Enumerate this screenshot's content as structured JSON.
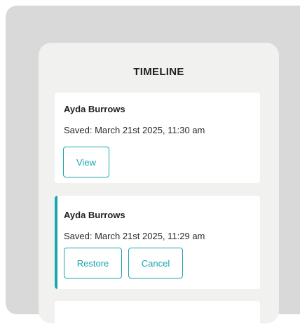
{
  "timeline": {
    "title": "TIMELINE",
    "entries": [
      {
        "author": "Ayda Burrows",
        "saved": "Saved: March 21st 2025, 11:30 am",
        "actions": {
          "view": "View"
        }
      },
      {
        "author": "Ayda Burrows",
        "saved": "Saved: March 21st 2025, 11:29 am",
        "selected": true,
        "actions": {
          "restore": "Restore",
          "cancel": "Cancel"
        }
      }
    ]
  },
  "colors": {
    "accent": "#1aa5b1",
    "backdrop": "#d9d9d9",
    "panel": "#f1f1ef",
    "card": "#ffffff"
  }
}
